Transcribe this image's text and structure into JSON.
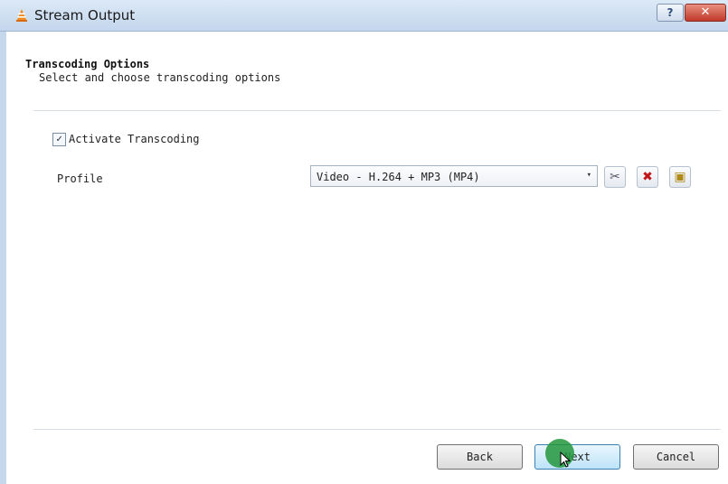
{
  "window": {
    "title": "Stream Output",
    "help_label": "?",
    "close_label": "✕"
  },
  "section": {
    "title": "Transcoding Options",
    "subtitle": "Select and choose transcoding options"
  },
  "transcoding": {
    "activate_label": "Activate Transcoding",
    "activate_checked": true,
    "check_mark": "✓"
  },
  "profile": {
    "label": "Profile",
    "selected": "Video - H.264 + MP3 (MP4)",
    "arrow": "▾",
    "edit_icon": "✂",
    "delete_icon": "✖",
    "new_icon": "▣"
  },
  "buttons": {
    "back": "Back",
    "next": "Next",
    "cancel": "Cancel"
  },
  "colors": {
    "titlebar": "#c3d6ec",
    "close": "#c0392b",
    "click_marker": "#22963c"
  },
  "icons": {
    "app": "vlc-cone-icon",
    "edit": "scissors-icon",
    "delete": "red-x-icon",
    "new": "new-profile-icon",
    "cursor": "mouse-cursor-icon"
  }
}
